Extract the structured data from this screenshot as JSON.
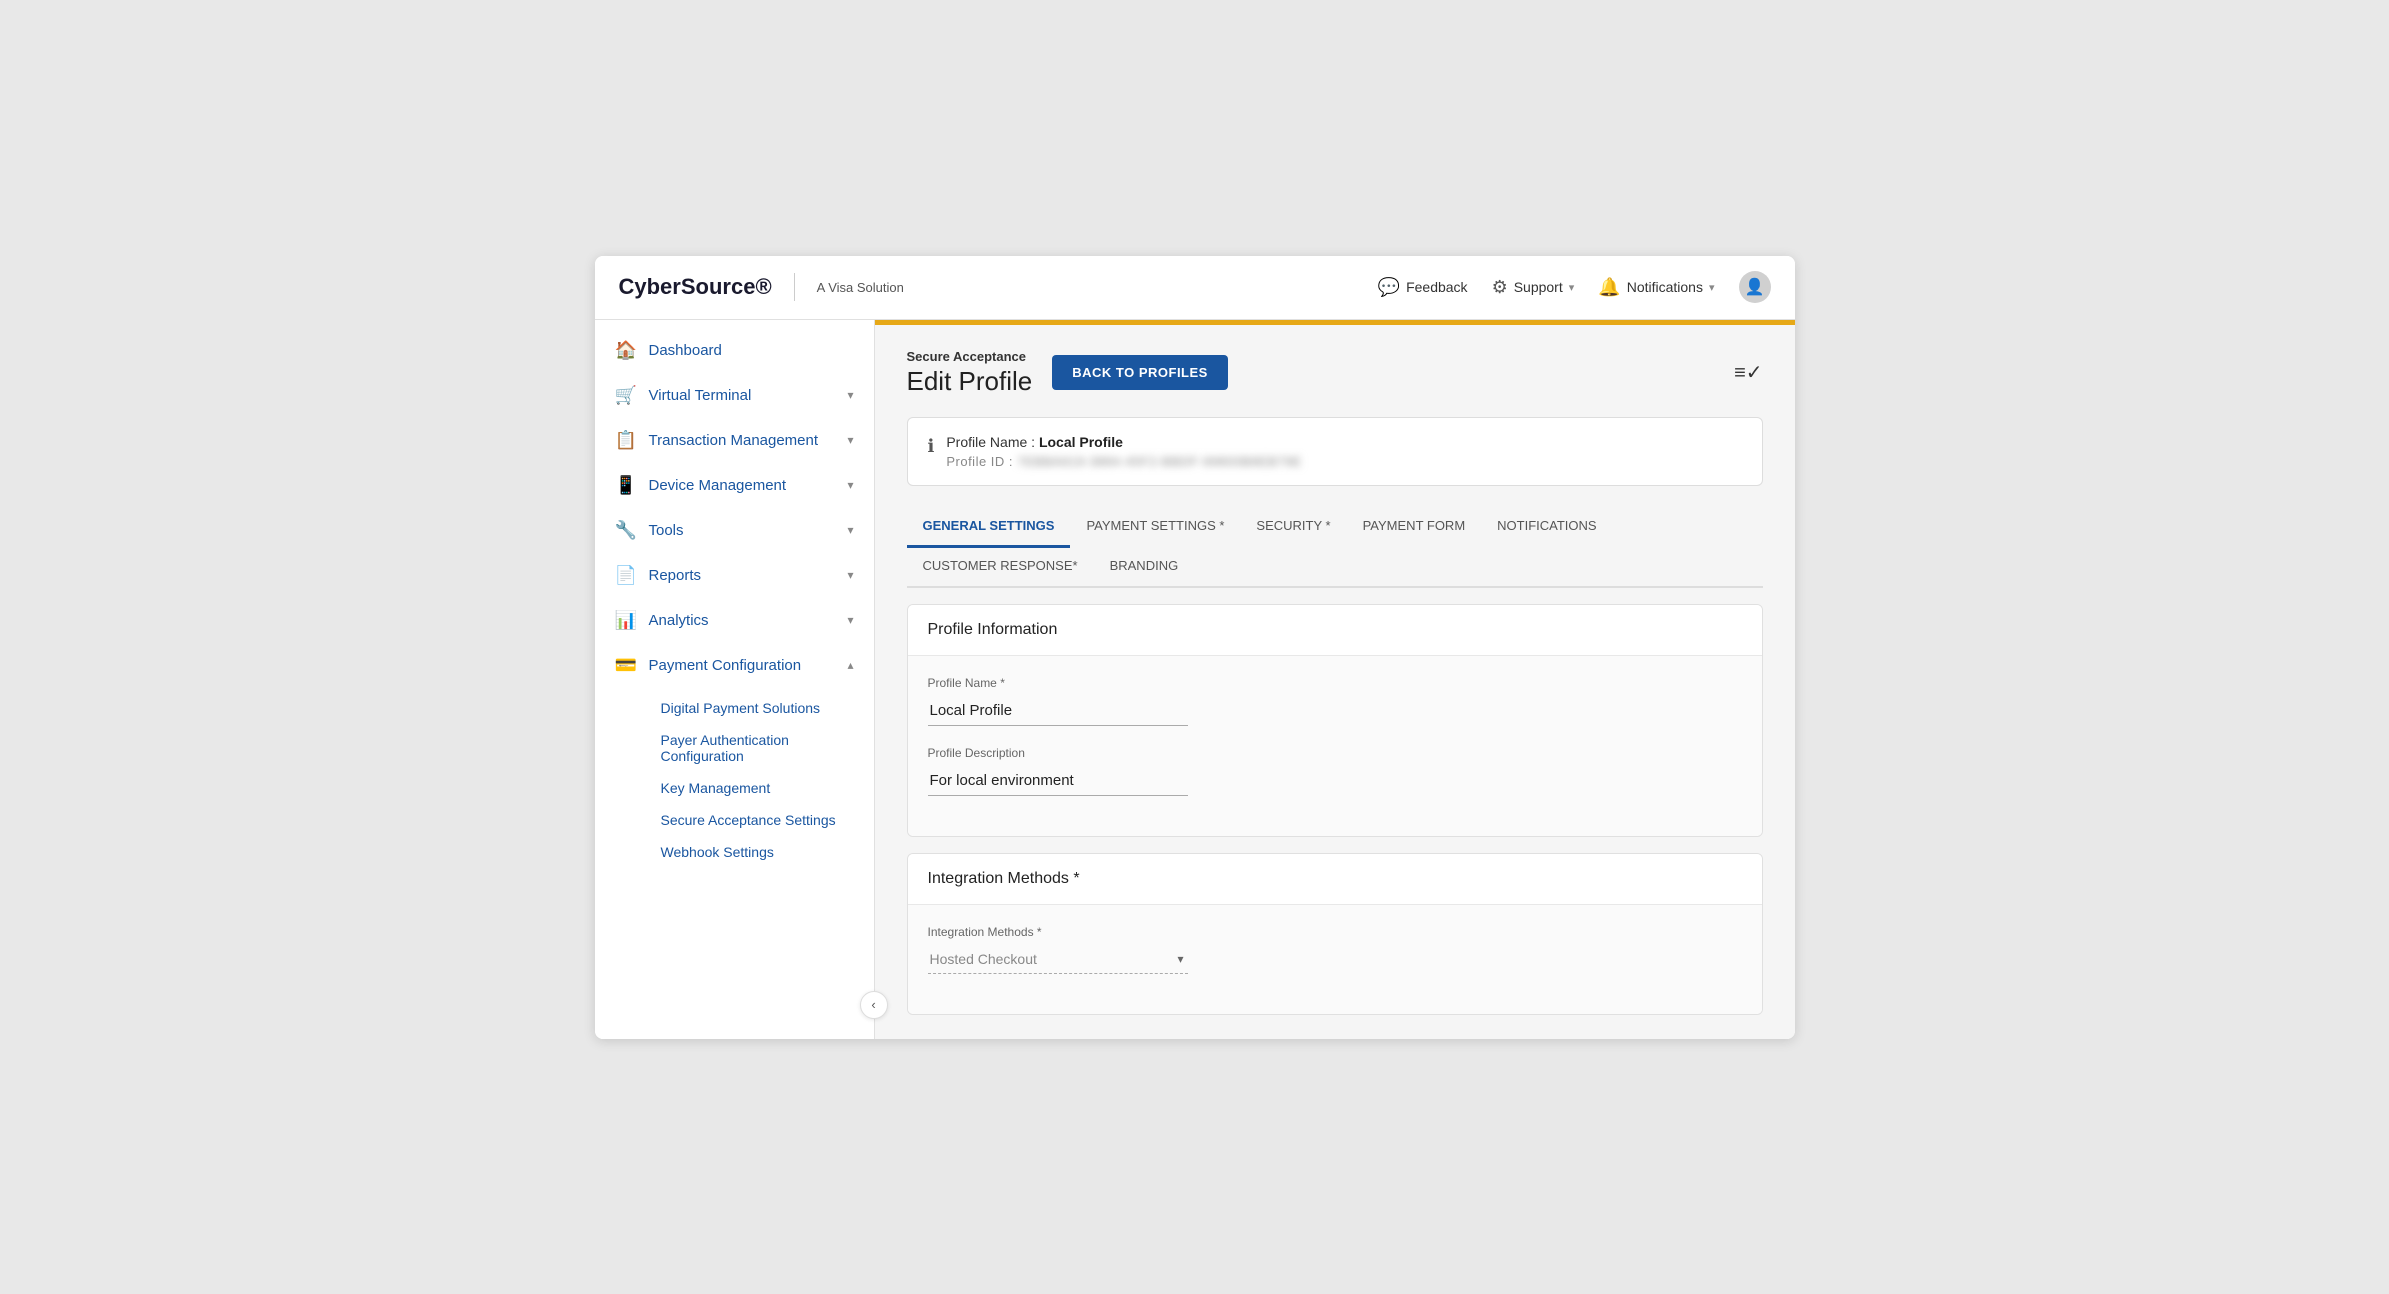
{
  "header": {
    "logo": "CyberSource®",
    "logo_sup": "®",
    "subtitle": "A Visa Solution",
    "feedback_label": "Feedback",
    "support_label": "Support",
    "notifications_label": "Notifications",
    "user_icon": "👤"
  },
  "sidebar": {
    "items": [
      {
        "id": "dashboard",
        "label": "Dashboard",
        "icon": "🏠",
        "hasChevron": false
      },
      {
        "id": "virtual-terminal",
        "label": "Virtual Terminal",
        "icon": "🛒",
        "hasChevron": true
      },
      {
        "id": "transaction-management",
        "label": "Transaction Management",
        "icon": "📋",
        "hasChevron": true
      },
      {
        "id": "device-management",
        "label": "Device Management",
        "icon": "📱",
        "hasChevron": true
      },
      {
        "id": "tools",
        "label": "Tools",
        "icon": "🔧",
        "hasChevron": true
      },
      {
        "id": "reports",
        "label": "Reports",
        "icon": "📄",
        "hasChevron": true
      },
      {
        "id": "analytics",
        "label": "Analytics",
        "icon": "📊",
        "hasChevron": true
      },
      {
        "id": "payment-configuration",
        "label": "Payment Configuration",
        "icon": "💳",
        "hasChevron": true,
        "expanded": true
      }
    ],
    "sub_items": [
      "Digital Payment Solutions",
      "Payer Authentication Configuration",
      "Key Management",
      "Secure Acceptance Settings",
      "Webhook Settings"
    ],
    "collapse_icon": "‹"
  },
  "content": {
    "gold_banner": true,
    "breadcrumb": "Secure Acceptance",
    "page_title": "Edit Profile",
    "back_button": "BACK TO PROFILES",
    "checklist_icon": "≡✓",
    "profile_info": {
      "icon": "ℹ",
      "name_label": "Profile Name : ",
      "name_value": "Local Profile",
      "id_label": "Profile ID : ",
      "id_value": "7EBBA919-3884-45F2-BBDF-99800B8EB79E"
    },
    "tabs": [
      {
        "id": "general-settings",
        "label": "GENERAL SETTINGS",
        "active": true
      },
      {
        "id": "payment-settings",
        "label": "PAYMENT SETTINGS *",
        "active": false
      },
      {
        "id": "security",
        "label": "SECURITY *",
        "active": false
      },
      {
        "id": "payment-form",
        "label": "PAYMENT FORM",
        "active": false
      },
      {
        "id": "notifications",
        "label": "NOTIFICATIONS",
        "active": false
      },
      {
        "id": "customer-response",
        "label": "CUSTOMER RESPONSE*",
        "active": false
      },
      {
        "id": "branding",
        "label": "BRANDING",
        "active": false
      }
    ],
    "profile_information_section": {
      "title": "Profile Information",
      "fields": [
        {
          "label": "Profile Name *",
          "value": "Local Profile",
          "id": "profile-name"
        },
        {
          "label": "Profile Description",
          "value": "For local environment",
          "id": "profile-description"
        }
      ]
    },
    "integration_methods_section": {
      "title": "Integration Methods *",
      "field_label": "Integration Methods *",
      "field_value": "Hosted Checkout",
      "field_placeholder": "Hosted Checkout"
    }
  }
}
